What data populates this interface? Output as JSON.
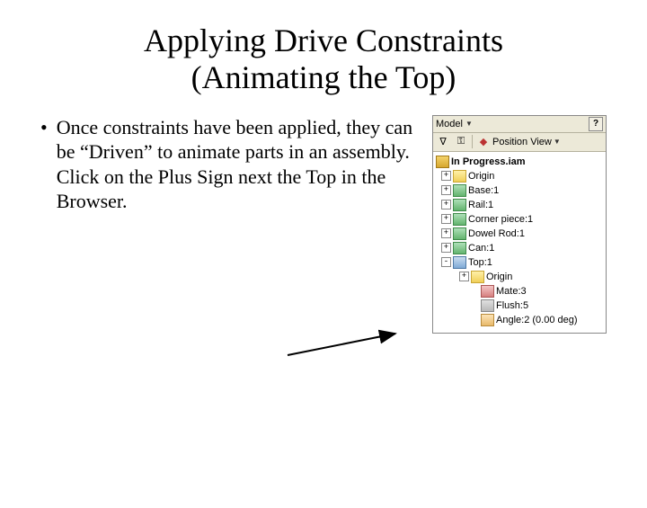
{
  "title_line1": "Applying Drive Constraints",
  "title_line2": "(Animating the Top)",
  "bullet_text": "Once constraints have been applied, they can be “Driven” to animate parts in an assembly. Click on the Plus Sign next the Top in the Browser.",
  "panel": {
    "model_label": "Model",
    "help_char": "?",
    "filter_icon": "∇",
    "key_icon": "⚿",
    "pos_icon": "◆",
    "pos_label": "Position View",
    "root": "In Progress.iam",
    "items": [
      {
        "label": "Origin",
        "icon": "folder",
        "box": "+"
      },
      {
        "label": "Base:1",
        "icon": "part",
        "box": "+"
      },
      {
        "label": "Rail:1",
        "icon": "part",
        "box": "+"
      },
      {
        "label": "Corner piece:1",
        "icon": "part",
        "box": "+"
      },
      {
        "label": "Dowel Rod:1",
        "icon": "part",
        "box": "+"
      },
      {
        "label": "Can:1",
        "icon": "part",
        "box": "+"
      },
      {
        "label": "Top:1",
        "icon": "top",
        "box": "-"
      }
    ],
    "children": [
      {
        "label": "Origin",
        "icon": "folder",
        "box": "+"
      },
      {
        "label": "Mate:3",
        "icon": "mate",
        "box": ""
      },
      {
        "label": "Flush:5",
        "icon": "flush",
        "box": ""
      },
      {
        "label": "Angle:2 (0.00 deg)",
        "icon": "angle",
        "box": ""
      }
    ]
  }
}
